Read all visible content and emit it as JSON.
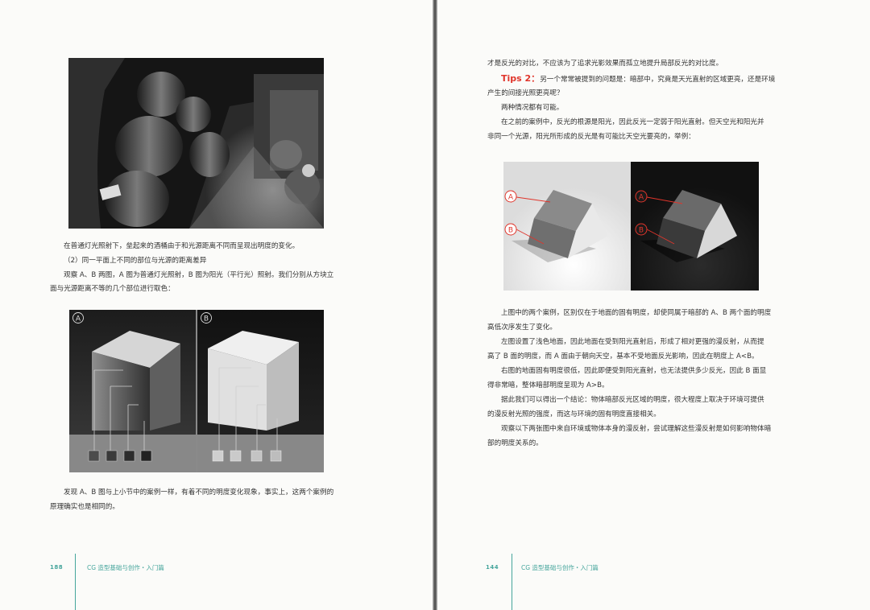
{
  "left": {
    "photo_caption": "在普通灯光照射下，垒起来的酒桶由于和光源距离不同而呈现出明度的变化。",
    "subheading": "（2）同一平面上不同的部位与光源的距离差异",
    "para1_line1": "观察 A、B 两图，A 图为普通灯光照射，B 图为阳光（平行光）照射。我们分别从方块立",
    "para1_line2": "面与光源距离不等的几个部位进行取色：",
    "figure_label_a": "A",
    "figure_label_b": "B",
    "para2_line1": "发现 A、B 图与上小节中的案例一样，有着不同的明度变化现象，事实上，这两个案例的",
    "para2_line2": "原理确实也是相同的。",
    "page_number": "188",
    "footer_title": "CG 造型基础与创作・入门篇"
  },
  "right": {
    "line1": "才是反光的对比，不应该为了追求光影效果而孤立地提升局部反光的对比度。",
    "tips_label": "Tips 2：",
    "tips_text": "另一个常常被提到的问题是：暗部中，究竟是天光直射的区域更亮，还是环境",
    "tips_line2": "产生的间接光照更亮呢？",
    "line_possible": "两种情况都有可能。",
    "para_a1": "在之前的案例中，反光的根源是阳光，因此反光一定弱于阳光直射。但天空光和阳光并",
    "para_a2": "非同一个光源，阳光所形成的反光是有可能比天空光要亮的，举例：",
    "figure_label_a": "A",
    "figure_label_b": "B",
    "p1_l1": "上图中的两个案例，区别仅在于地面的固有明度，却使同属于暗部的 A、B 两个面的明度",
    "p1_l2": "高低次序发生了变化。",
    "p2_l1": "左图设置了浅色地面，因此地面在受到阳光直射后，形成了相对更强的漫反射，从而提",
    "p2_l2": "高了 B 面的明度，而 A 面由于朝向天空，基本不受地面反光影响，因此在明度上 A<B。",
    "p3_l1": "右图的地面固有明度很低，因此即便受到阳光直射，也无法提供多少反光，因此 B 面显",
    "p3_l2": "得非常暗，整体暗部明度呈现为 A>B。",
    "p4_l1": "据此我们可以得出一个结论：物体暗部反光区域的明度，很大程度上取决于环境可提供",
    "p4_l2": "的漫反射光照的强度，而这与环境的固有明度直接相关。",
    "p5_l1": "观察以下两张图中来自环境或物体本身的漫反射，尝试理解这些漫反射是如何影响物体暗",
    "p5_l2": "部的明度关系的。",
    "page_number": "144",
    "footer_title": "CG 造型基础与创作・入门篇"
  }
}
